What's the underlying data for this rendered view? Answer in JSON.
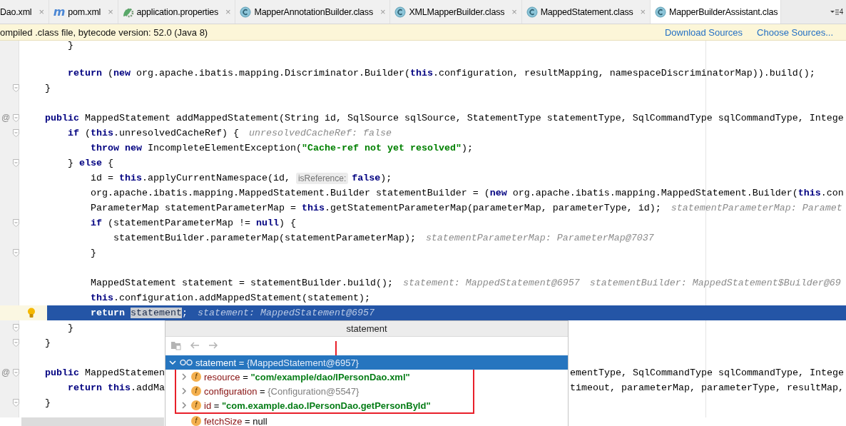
{
  "tabs": [
    {
      "label": "Dao.xml",
      "close": "×",
      "selected": false
    },
    {
      "label": "pom.xml",
      "kind": "maven",
      "icon_text": "m",
      "close": "×",
      "selected": false
    },
    {
      "label": "application.properties",
      "kind": "properties",
      "close": "×",
      "selected": false
    },
    {
      "label": "MapperAnnotationBuilder.class",
      "kind": "class",
      "close": "×",
      "selected": false
    },
    {
      "label": "XMLMapperBuilder.class",
      "kind": "class",
      "close": "×",
      "selected": false
    },
    {
      "label": "MappedStatement.class",
      "kind": "class",
      "close": "×",
      "selected": false
    },
    {
      "label": "MapperBuilderAssistant.clas",
      "kind": "class",
      "selected": true
    }
  ],
  "tab_overflow": {
    "count": "4"
  },
  "notification": {
    "message": "ompiled .class file, bytecode version: 52.0 (Java 8)",
    "links": [
      "Download Sources",
      "Choose Sources..."
    ]
  },
  "editor": {
    "lines": [
      {
        "selected": false,
        "tokens": [
          {
            "kind": "code",
            "text": "        }"
          }
        ]
      },
      {
        "selected": false
      },
      {
        "selected": false,
        "tokens": [
          {
            "kind": "kw",
            "text": "        return"
          },
          {
            "kind": "code",
            "text": " ("
          },
          {
            "kind": "kw",
            "text": "new"
          },
          {
            "kind": "code",
            "text": " org.apache.ibatis.mapping.Discriminator.Builder("
          },
          {
            "kind": "kw",
            "text": "this"
          },
          {
            "kind": "code",
            "text": ".configuration, resultMapping, namespaceDiscriminatorMap)).build();"
          }
        ]
      },
      {
        "selected": false,
        "fold": true,
        "tokens": [
          {
            "kind": "code",
            "text": "    }"
          }
        ]
      },
      {
        "selected": false
      },
      {
        "selected": false,
        "fold": true,
        "gutter": "@",
        "tokens": [
          {
            "kind": "kw",
            "text": "    public"
          },
          {
            "kind": "code",
            "text": " MappedStatement addMappedStatement(String id, SqlSource sqlSource, StatementType statementType, SqlCommandType sqlCommandType, Intege"
          }
        ]
      },
      {
        "selected": false,
        "fold": true,
        "tokens": [
          {
            "kind": "kw",
            "text": "        if"
          },
          {
            "kind": "code",
            "text": " ("
          },
          {
            "kind": "kw",
            "text": "this"
          },
          {
            "kind": "code",
            "text": ".unresolvedCacheRef) {"
          },
          {
            "kind": "hint",
            "text": "unresolvedCacheRef: false"
          }
        ]
      },
      {
        "selected": false,
        "tokens": [
          {
            "kind": "kw",
            "text": "            throw"
          },
          {
            "kind": "kw",
            "text": " new"
          },
          {
            "kind": "code",
            "text": " IncompleteElementException("
          },
          {
            "kind": "str",
            "text": "\"Cache-ref not yet resolved\""
          },
          {
            "kind": "code",
            "text": ");"
          }
        ]
      },
      {
        "selected": false,
        "fold": true,
        "tokens": [
          {
            "kind": "code",
            "text": "        } "
          },
          {
            "kind": "kw",
            "text": "else"
          },
          {
            "kind": "code",
            "text": " {"
          }
        ]
      },
      {
        "selected": false,
        "tokens": [
          {
            "kind": "code",
            "text": "            id = "
          },
          {
            "kind": "kw",
            "text": "this"
          },
          {
            "kind": "code",
            "text": ".applyCurrentNamespace(id, "
          },
          {
            "kind": "param",
            "text": "isReference:"
          },
          {
            "kind": "kw",
            "text": "false"
          },
          {
            "kind": "code",
            "text": ");"
          }
        ]
      },
      {
        "selected": false,
        "tokens": [
          {
            "kind": "code",
            "text": "            org.apache.ibatis.mapping.MappedStatement.Builder statementBuilder = ("
          },
          {
            "kind": "kw",
            "text": "new"
          },
          {
            "kind": "code",
            "text": " org.apache.ibatis.mapping.MappedStatement.Builder("
          },
          {
            "kind": "kw",
            "text": "this"
          },
          {
            "kind": "code",
            "text": ".con"
          }
        ]
      },
      {
        "selected": false,
        "tokens": [
          {
            "kind": "code",
            "text": "            ParameterMap statementParameterMap = "
          },
          {
            "kind": "kw",
            "text": "this"
          },
          {
            "kind": "code",
            "text": ".getStatementParameterMap(parameterMap, parameterType, id);"
          },
          {
            "kind": "hint",
            "text": "statementParameterMap: Paramet"
          }
        ]
      },
      {
        "selected": false,
        "fold": true,
        "tokens": [
          {
            "kind": "kw",
            "text": "            if"
          },
          {
            "kind": "code",
            "text": " (statementParameterMap != "
          },
          {
            "kind": "kw",
            "text": "null"
          },
          {
            "kind": "code",
            "text": ") {"
          }
        ]
      },
      {
        "selected": false,
        "tokens": [
          {
            "kind": "code",
            "text": "                statementBuilder.parameterMap(statementParameterMap);"
          },
          {
            "kind": "hint",
            "text": "statementParameterMap: ParameterMap@7037"
          }
        ]
      },
      {
        "selected": false,
        "fold": true,
        "tokens": [
          {
            "kind": "code",
            "text": "            }"
          }
        ]
      },
      {
        "selected": false
      },
      {
        "selected": false,
        "tokens": [
          {
            "kind": "code",
            "text": "            MappedStatement statement = statementBuilder.build();"
          },
          {
            "kind": "hint",
            "text": "statement: MappedStatement@6957"
          },
          {
            "kind": "hint",
            "text": "statementBuilder: MappedStatement$Builder@69"
          }
        ]
      },
      {
        "selected": false,
        "tokens": [
          {
            "kind": "kw",
            "text": "            this"
          },
          {
            "kind": "code",
            "text": ".configuration.addMappedStatement(statement);"
          }
        ]
      },
      {
        "selected": true,
        "bulb": true,
        "tokens": [
          {
            "kind": "kw",
            "text": "            return "
          },
          {
            "kind": "sel",
            "text": "statement"
          },
          {
            "kind": "code",
            "text": ";"
          },
          {
            "kind": "hint",
            "text": "statement: MappedStatement@6957"
          }
        ]
      },
      {
        "selected": false,
        "fold": true,
        "tokens": [
          {
            "kind": "code",
            "text": "        }"
          }
        ]
      },
      {
        "selected": false,
        "fold": true,
        "tokens": [
          {
            "kind": "code",
            "text": "    }"
          }
        ]
      },
      {
        "selected": false
      },
      {
        "selected": false,
        "fold": true,
        "gutter": "@",
        "tokens": [
          {
            "kind": "kw",
            "text": "    public"
          },
          {
            "kind": "code",
            "text": " MappedStatemen"
          }
        ],
        "tail": [
          {
            "kind": "code",
            "text": "ementType, SqlCommandType sqlCommandType, Intege"
          }
        ]
      },
      {
        "selected": false,
        "tokens": [
          {
            "kind": "kw",
            "text": "        return"
          },
          {
            "kind": "kw",
            "text": " this"
          },
          {
            "kind": "code",
            "text": ".addMa"
          }
        ],
        "tail": [
          {
            "kind": "code",
            "text": "timeout, parameterMap, parameterType, resultMap,"
          }
        ]
      },
      {
        "selected": false,
        "fold": true,
        "tokens": [
          {
            "kind": "code",
            "text": "    }"
          }
        ]
      }
    ]
  },
  "popup": {
    "title": "statement",
    "toolbar": [
      {
        "kind": "tree",
        "disabled": true
      },
      {
        "kind": "back",
        "disabled": true
      },
      {
        "kind": "forward",
        "disabled": true
      }
    ],
    "nodes": [
      {
        "name": "statement",
        "operator": "=",
        "value": "{MappedStatement@6957}",
        "kind": "object",
        "expanded": true,
        "selected": true,
        "children": [
          {
            "name": "resource",
            "operator": "=",
            "value": "\"com/example/dao/IPersonDao.xml\"",
            "kind": "string",
            "icon_text": "f",
            "expanded": false,
            "selected": false
          },
          {
            "name": "configuration",
            "operator": "=",
            "value": "{Configuration@5547}",
            "kind": "object",
            "icon_text": "f",
            "expanded": false,
            "selected": false
          },
          {
            "name": "id",
            "operator": "=",
            "value": "\"com.example.dao.IPersonDao.getPersonById\"",
            "kind": "string",
            "icon_text": "f",
            "expanded": false,
            "selected": false
          },
          {
            "name": "fetchSize",
            "operator": "=",
            "value": "null",
            "kind": "null",
            "icon_text": "f",
            "selected": false
          }
        ]
      }
    ]
  }
}
